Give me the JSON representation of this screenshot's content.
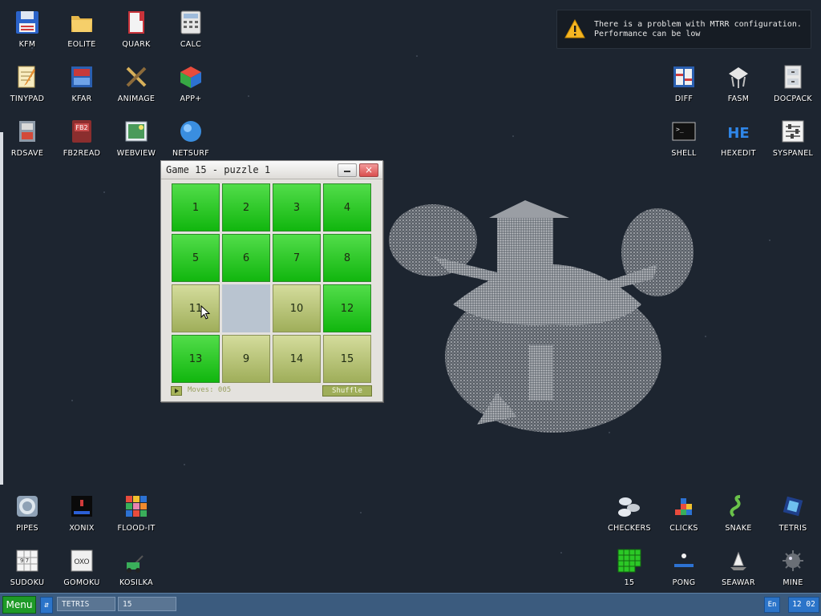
{
  "desktop": {
    "icons_top_left": [
      {
        "label": "KFM",
        "icon": "floppy-icon"
      },
      {
        "label": "EOLITE",
        "icon": "folder-icon"
      },
      {
        "label": "QUARK",
        "icon": "book-icon"
      },
      {
        "label": "CALC",
        "icon": "calculator-icon"
      },
      {
        "label": "TINYPAD",
        "icon": "notepad-icon"
      },
      {
        "label": "KFAR",
        "icon": "archive-icon"
      },
      {
        "label": "ANIMAGE",
        "icon": "paint-tools-icon"
      },
      {
        "label": "APP+",
        "icon": "cube-icon"
      },
      {
        "label": "RDSAVE",
        "icon": "disk-save-icon"
      },
      {
        "label": "FB2READ",
        "icon": "fb2-book-icon"
      },
      {
        "label": "WEBVIEW",
        "icon": "web-image-icon"
      },
      {
        "label": "NETSURF",
        "icon": "globe-icon"
      }
    ],
    "icons_top_right": [
      {
        "label": "DIFF",
        "icon": "diff-icon"
      },
      {
        "label": "FASM",
        "icon": "server-icon"
      },
      {
        "label": "DOCPACK",
        "icon": "cabinet-icon"
      },
      {
        "label": "SHELL",
        "icon": "terminal-icon"
      },
      {
        "label": "HEXEDIT",
        "icon": "hex-icon"
      },
      {
        "label": "SYSPANEL",
        "icon": "sliders-icon"
      }
    ],
    "icons_bottom_left": [
      {
        "label": "PIPES",
        "icon": "pipes-icon"
      },
      {
        "label": "XONIX",
        "icon": "xonix-icon"
      },
      {
        "label": "FLOOD-IT",
        "icon": "color-grid-icon"
      },
      {
        "label": "SUDOKU",
        "icon": "sudoku-icon"
      },
      {
        "label": "GOMOKU",
        "icon": "gomoku-icon"
      },
      {
        "label": "KOSILKA",
        "icon": "lawnmower-icon"
      }
    ],
    "icons_bottom_right": [
      {
        "label": "CHECKERS",
        "icon": "checkers-icon"
      },
      {
        "label": "CLICKS",
        "icon": "blocks-icon"
      },
      {
        "label": "SNAKE",
        "icon": "snake-icon"
      },
      {
        "label": "TETRIS",
        "icon": "tetris-icon"
      },
      {
        "label": "15",
        "icon": "fifteen-grid-icon"
      },
      {
        "label": "PONG",
        "icon": "pong-icon"
      },
      {
        "label": "SEAWAR",
        "icon": "seawar-icon"
      },
      {
        "label": "MINE",
        "icon": "mine-icon"
      }
    ]
  },
  "notification": {
    "line1": "There is a problem with MTRR configuration.",
    "line2": "Performance can be low",
    "icon": "warning-icon",
    "accent": "#f5b623"
  },
  "game": {
    "title": "Game 15 - puzzle 1",
    "minimize": "–",
    "close": "×",
    "tiles": [
      {
        "label": "1",
        "state": "ok"
      },
      {
        "label": "2",
        "state": "ok"
      },
      {
        "label": "3",
        "state": "ok"
      },
      {
        "label": "4",
        "state": "ok"
      },
      {
        "label": "5",
        "state": "ok"
      },
      {
        "label": "6",
        "state": "ok"
      },
      {
        "label": "7",
        "state": "ok"
      },
      {
        "label": "8",
        "state": "ok"
      },
      {
        "label": "11",
        "state": "bad"
      },
      {
        "label": "",
        "state": "empty"
      },
      {
        "label": "10",
        "state": "bad"
      },
      {
        "label": "12",
        "state": "ok"
      },
      {
        "label": "13",
        "state": "ok"
      },
      {
        "label": "9",
        "state": "bad"
      },
      {
        "label": "14",
        "state": "bad"
      },
      {
        "label": "15",
        "state": "bad"
      }
    ],
    "moves": "Moves: 005",
    "shuffle": "Shuffle",
    "colors": {
      "correct": "#2bc826",
      "wrong": "#b9c27a",
      "empty": "#b9c4d0"
    }
  },
  "taskbar": {
    "menu": "Menu",
    "switch": "⇵",
    "tasks": [
      "TETRIS",
      "15"
    ],
    "lang": "En",
    "clock": "12 02",
    "colors": {
      "bar": "#3b5b7e",
      "menu": "#1e9a27",
      "accent": "#2b74c9"
    }
  }
}
